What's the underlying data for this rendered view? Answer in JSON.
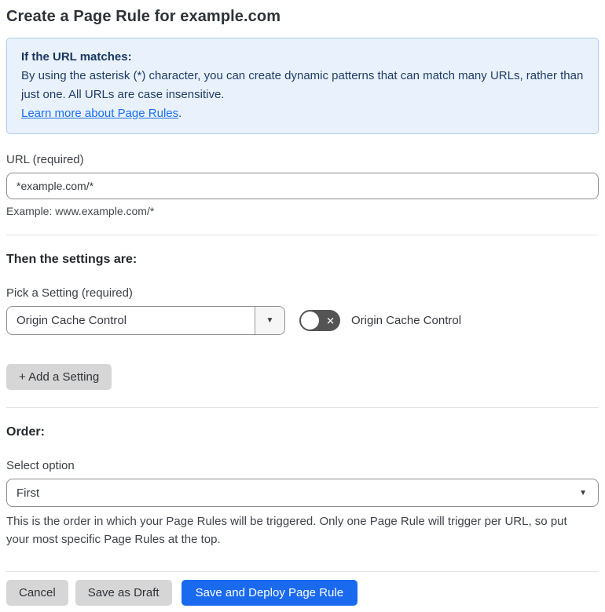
{
  "page": {
    "title": "Create a Page Rule for example.com"
  },
  "info_box": {
    "heading": "If the URL matches:",
    "body": "By using the asterisk (*) character, you can create dynamic patterns that can match many URLs, rather than just one. All URLs are case insensitive.",
    "link": "Learn more about Page Rules",
    "link_suffix": "."
  },
  "url_field": {
    "label": "URL (required)",
    "value": "*example.com/*",
    "helper": "Example: www.example.com/*"
  },
  "settings_section": {
    "heading": "Then the settings are:",
    "picker_label": "Pick a Setting (required)",
    "picker_value": "Origin Cache Control",
    "toggle_label": "Origin Cache Control",
    "toggle_state": "off",
    "add_setting_button": "+ Add a Setting"
  },
  "order_section": {
    "heading": "Order:",
    "select_label": "Select option",
    "select_value": "First",
    "helper": "This is the order in which your Page Rules will be triggered. Only one Page Rule will trigger per URL, so put your most specific Page Rules at the top."
  },
  "actions": {
    "cancel": "Cancel",
    "save_draft": "Save as Draft",
    "save_deploy": "Save and Deploy Page Rule"
  },
  "icons": {
    "caret_down": "▼",
    "toggle_off_x": "✕"
  },
  "colors": {
    "accent_blue": "#1a6af0",
    "link_blue": "#1a6ff0",
    "info_bg": "#e9f2fc",
    "info_border": "#a9cdf1",
    "info_text": "#1f3c66",
    "toggle_off_bg": "#545454",
    "button_gray": "#d6d6d6"
  }
}
